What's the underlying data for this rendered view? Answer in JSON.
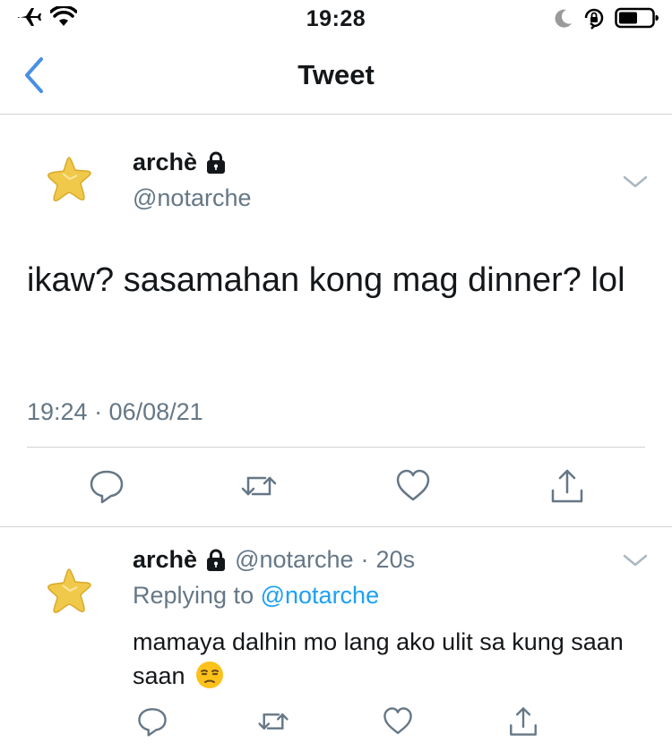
{
  "status_bar": {
    "time": "19:28",
    "icons": [
      "airplane-icon",
      "wifi-icon",
      "moon-icon",
      "orientation-lock-icon",
      "battery-icon"
    ]
  },
  "nav": {
    "title": "Tweet",
    "back_icon": "chevron-left-icon"
  },
  "main_tweet": {
    "name": "archè",
    "handle": "@notarche",
    "text": "ikaw? sasamahan kong mag dinner? lol",
    "timestamp": "19:24 · 06/08/21",
    "actions": [
      "reply-icon",
      "retweet-icon",
      "like-icon",
      "share-icon"
    ]
  },
  "reply_tweet": {
    "name": "archè",
    "handle": "@notarche",
    "separator": "·",
    "time_ago": "20s",
    "replying_prefix": "Replying to",
    "replying_to": "@notarche",
    "text": "mamaya dalhin mo lang ako ulit sa kung saan saan",
    "emoji": "unamused-face-emoji",
    "actions": [
      "reply-icon",
      "retweet-icon",
      "like-icon",
      "share-icon"
    ]
  },
  "colors": {
    "accent": "#1da1f2",
    "back_arrow": "#4a90e2",
    "secondary_text": "#657786",
    "divider": "#cfd3d6",
    "star_fill": "#f1c94a"
  }
}
